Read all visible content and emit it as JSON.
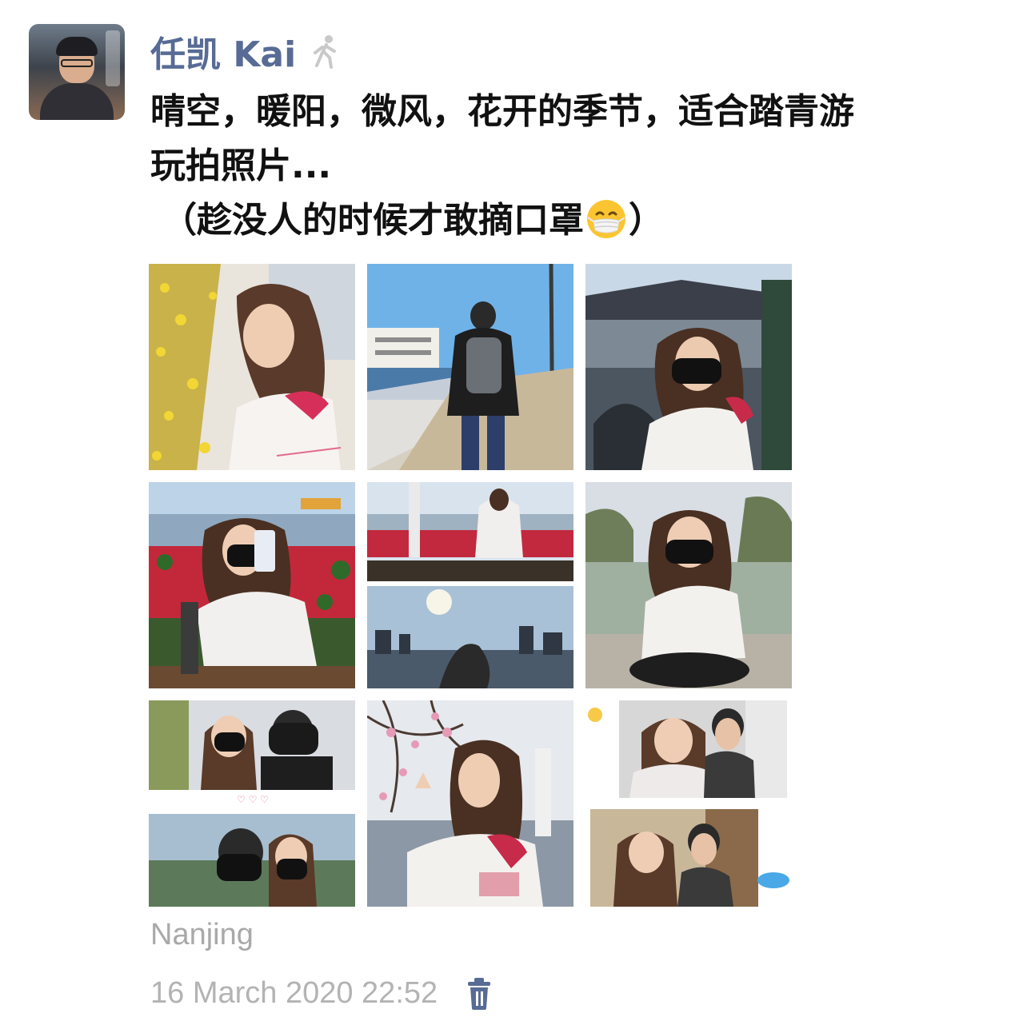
{
  "post": {
    "author": "任凯 Kai",
    "status_icon": "walking-person-icon",
    "text_lines": [
      "晴空，暖阳，微风，花开的季节，适合踏青游",
      "玩拍照片...",
      "（趁没人的时候才敢摘口罩",
      "）"
    ],
    "emoji": "face-with-medical-mask-emoji",
    "location": "Nanjing",
    "timestamp": "16 March 2020 22:52",
    "delete_icon": "trash-icon"
  },
  "photos": [
    {
      "name": "photo-forsythia-portrait"
    },
    {
      "name": "photo-riverside-walkway"
    },
    {
      "name": "photo-gate-tower-portrait"
    },
    {
      "name": "photo-lakeside-phone-selfie"
    },
    {
      "name": "photo-bench-and-sunset-collage"
    },
    {
      "name": "photo-lakeshore-seated"
    },
    {
      "name": "photo-couple-masked-collage"
    },
    {
      "name": "photo-plum-blossom-portrait"
    },
    {
      "name": "photo-couple-home-collage"
    }
  ],
  "colors": {
    "author_name": "#576b95",
    "body_text": "#111111",
    "meta_text": "#b3b3b3"
  }
}
